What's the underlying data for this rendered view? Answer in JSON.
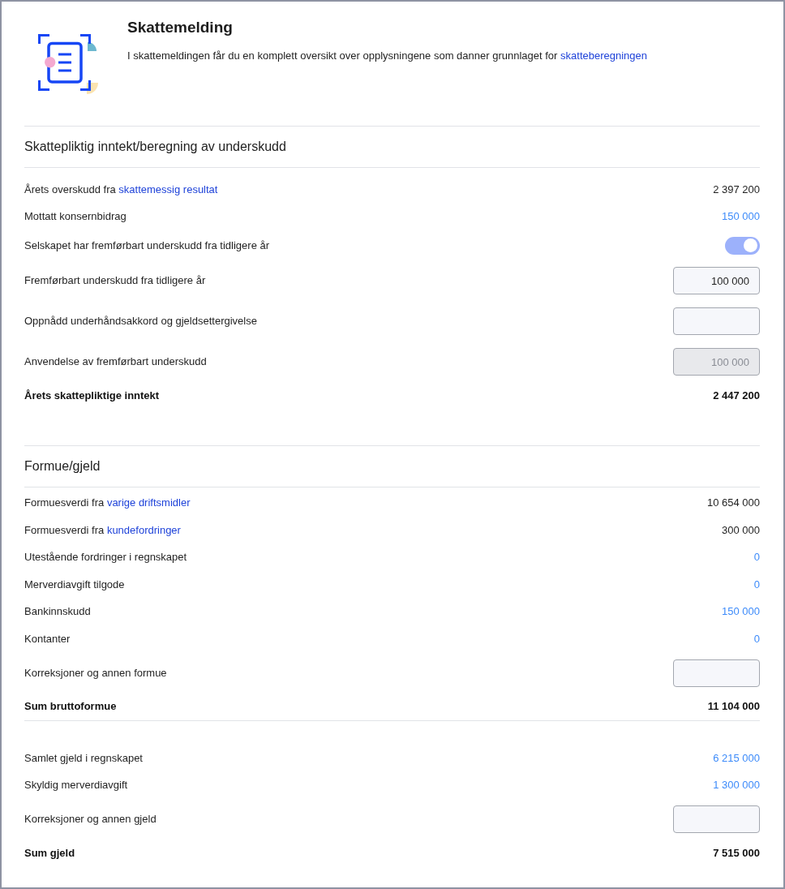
{
  "header": {
    "title": "Skattemelding",
    "description": "I skattemeldingen får du en komplett oversikt over opplysningene som danner grunnlaget for",
    "description_link": "skatteberegningen"
  },
  "sections": [
    {
      "title": "Skattepliktig inntekt/beregning av underskudd",
      "groups": [
        {
          "rows": [
            {
              "kind": "value",
              "label": "Årets overskudd fra",
              "link": "skattemessig resultat",
              "value": "2 397 200",
              "linked": false
            },
            {
              "kind": "value",
              "label": "Mottatt konsernbidrag",
              "value": "150 000",
              "linked": true
            },
            {
              "kind": "toggle",
              "label": "Selskapet har fremførbart underskudd fra tidligere år",
              "on": true
            },
            {
              "kind": "input",
              "label": "Fremførbart underskudd fra tidligere år",
              "value": "100 000",
              "disabled": false
            },
            {
              "kind": "input",
              "label": "Oppnådd underhåndsakkord og gjeldsettergivelse",
              "disabled": false
            },
            {
              "kind": "input",
              "label": "Anvendelse av fremførbart underskudd",
              "value": "100 000",
              "disabled": true
            },
            {
              "kind": "total",
              "label": "Årets skattepliktige inntekt",
              "value": "2 447 200"
            }
          ]
        }
      ]
    },
    {
      "title": "Formue/gjeld",
      "groups": [
        {
          "rows": [
            {
              "kind": "value",
              "label": "Formuesverdi fra",
              "link": "varige driftsmidler",
              "value": "10 654 000",
              "linked": false
            },
            {
              "kind": "value",
              "label": "Formuesverdi fra",
              "link": "kundefordringer",
              "value": "300 000",
              "linked": false
            },
            {
              "kind": "value",
              "label": "Utestående fordringer i regnskapet",
              "value": "0",
              "linked": true
            },
            {
              "kind": "value",
              "label": "Merverdiavgift tilgode",
              "value": "0",
              "linked": true
            },
            {
              "kind": "value",
              "label": "Bankinnskudd",
              "value": "150 000",
              "linked": true
            },
            {
              "kind": "value",
              "label": "Kontanter",
              "value": "0",
              "linked": true
            },
            {
              "kind": "input",
              "label": "Korreksjoner og annen formue",
              "disabled": false
            },
            {
              "kind": "total",
              "label": "Sum bruttoformue",
              "value": "11 104 000"
            }
          ]
        },
        {
          "rows": [
            {
              "kind": "value",
              "label": "Samlet gjeld i regnskapet",
              "value": "6 215 000",
              "linked": true
            },
            {
              "kind": "value",
              "label": "Skyldig merverdiavgift",
              "value": "1 300 000",
              "linked": true
            },
            {
              "kind": "input",
              "label": "Korreksjoner og annen gjeld",
              "disabled": false
            },
            {
              "kind": "total",
              "label": "Sum gjeld",
              "value": "7 515 000"
            }
          ]
        }
      ]
    }
  ]
}
